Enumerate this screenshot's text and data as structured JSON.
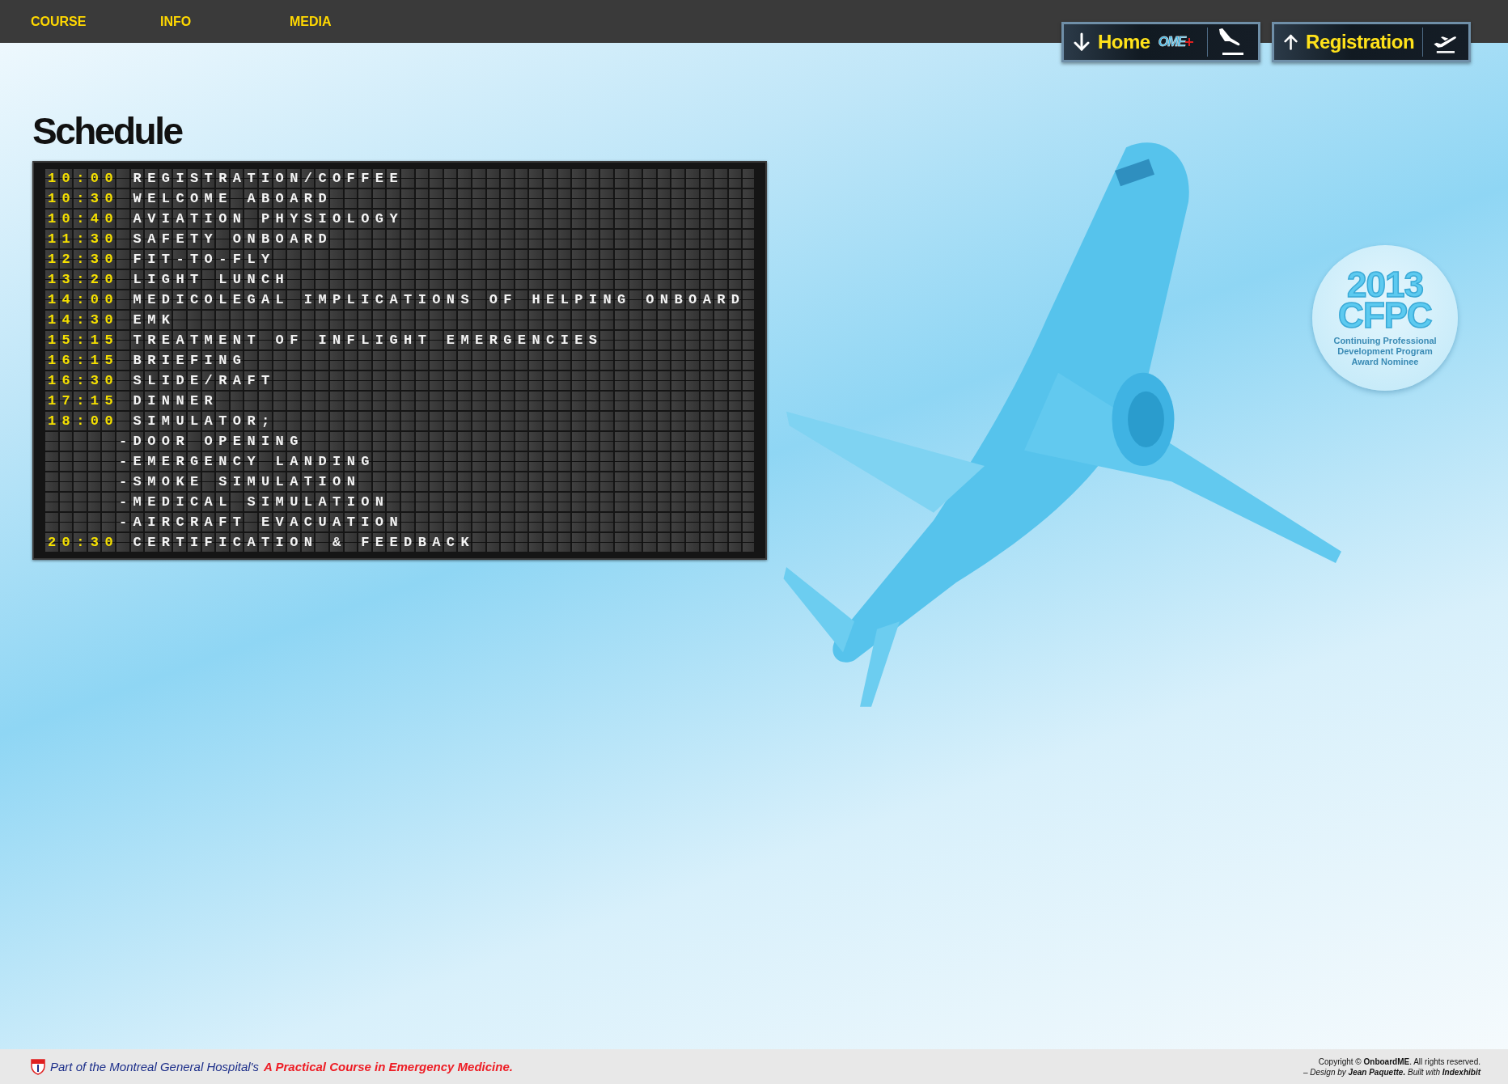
{
  "nav": [
    {
      "label": "COURSE"
    },
    {
      "label": "INFO"
    },
    {
      "label": "MEDIA"
    }
  ],
  "flight_buttons": [
    {
      "kind": "arrival",
      "label": "Home",
      "logo": "OME"
    },
    {
      "kind": "departure",
      "label": "Registration"
    }
  ],
  "title": "Schedule",
  "schedule": [
    {
      "kind": "event",
      "time": "10:00",
      "text": "REGISTRATION/COFFEE"
    },
    {
      "kind": "event",
      "time": "10:30",
      "text": "WELCOME ABOARD"
    },
    {
      "kind": "event",
      "time": "10:40",
      "text": "AVIATION PHYSIOLOGY"
    },
    {
      "kind": "event",
      "time": "11:30",
      "text": "SAFETY ONBOARD"
    },
    {
      "kind": "event",
      "time": "12:30",
      "text": "FIT-TO-FLY"
    },
    {
      "kind": "event",
      "time": "13:20",
      "text": "LIGHT LUNCH"
    },
    {
      "kind": "event",
      "time": "14:00",
      "text": "MEDICOLEGAL IMPLICATIONS OF HELPING ONBOARD"
    },
    {
      "kind": "event",
      "time": "14:30",
      "text": "EMK"
    },
    {
      "kind": "event",
      "time": "15:15",
      "text": "TREATMENT OF INFLIGHT EMERGENCIES"
    },
    {
      "kind": "event",
      "time": "16:15",
      "text": "BRIEFING"
    },
    {
      "kind": "event",
      "time": "16:30",
      "text": "SLIDE/RAFT"
    },
    {
      "kind": "event",
      "time": "17:15",
      "text": "DINNER"
    },
    {
      "kind": "event",
      "time": "18:00",
      "text": "SIMULATOR;"
    },
    {
      "kind": "sub",
      "text": "-DOOR OPENING"
    },
    {
      "kind": "sub",
      "text": "-EMERGENCY LANDING"
    },
    {
      "kind": "sub",
      "text": "-SMOKE SIMULATION"
    },
    {
      "kind": "sub",
      "text": "-MEDICAL SIMULATION"
    },
    {
      "kind": "sub",
      "text": "-AIRCRAFT EVACUATION"
    },
    {
      "kind": "event",
      "time": "20:30",
      "text": "CERTIFICATION & FEEDBACK"
    }
  ],
  "badge": {
    "year": "2013",
    "title": "CFPC",
    "caption": "Continuing Professional Development Program Award Nominee"
  },
  "footer": {
    "intro": "Part of the Montreal General Hospital's",
    "course_link": "A Practical Course in Emergency Medicine.",
    "copyright": "Copyright © **OnboardME**. All rights reserved.",
    "credits": "– Design by **Jean Paquette.** Built with **Indexhibit**"
  }
}
